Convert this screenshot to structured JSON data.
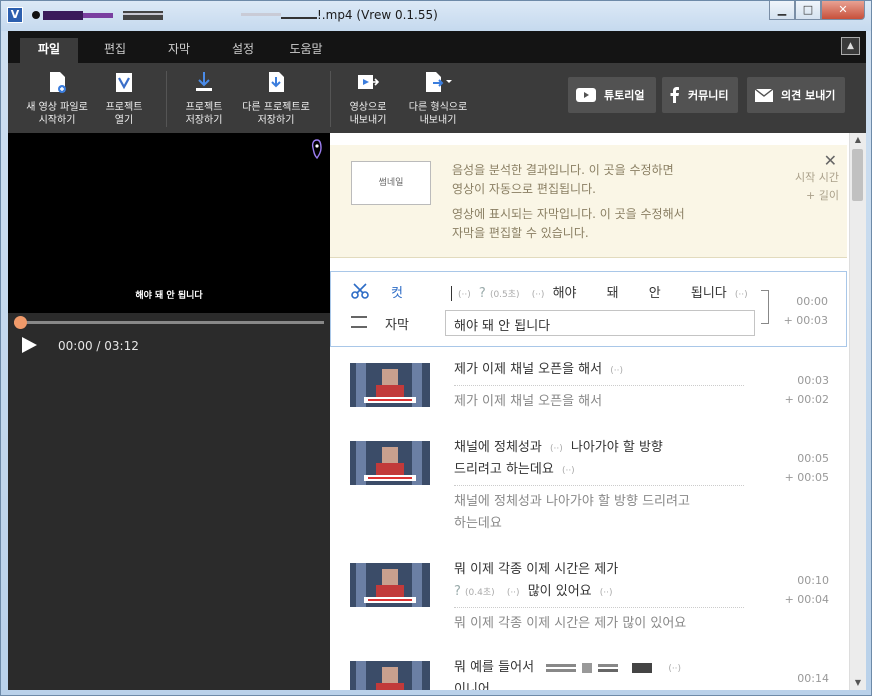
{
  "window": {
    "title": "!.mp4 (Vrew 0.1.55)",
    "app_icon": "V",
    "controls": {
      "minimize": "▁",
      "maximize": "□",
      "close": "✕"
    }
  },
  "menu": {
    "tabs": [
      "파일",
      "편집",
      "자막",
      "설정",
      "도움말"
    ],
    "active": "파일",
    "collapse_icon": "▲"
  },
  "ribbon": {
    "buttons": [
      {
        "label1": "새 영상 파일로",
        "label2": "시작하기",
        "icon": "new-file-icon"
      },
      {
        "label1": "프로젝트",
        "label2": "열기",
        "icon": "open-project-icon"
      },
      {
        "label1": "프로젝트",
        "label2": "저장하기",
        "icon": "save-icon"
      },
      {
        "label1": "다른 프로젝트로",
        "label2": "저장하기",
        "icon": "save-as-icon"
      },
      {
        "label1": "영상으로",
        "label2": "내보내기",
        "icon": "export-video-icon"
      },
      {
        "label1": "다른 형식으로",
        "label2": "내보내기",
        "icon": "export-format-icon"
      }
    ],
    "links": [
      {
        "label": "튜토리얼",
        "icon": "youtube-icon"
      },
      {
        "label": "커뮤니티",
        "icon": "facebook-icon"
      },
      {
        "label": "의견 보내기",
        "icon": "mail-icon"
      }
    ]
  },
  "player": {
    "caption": "해야 돼 안 됩니다",
    "time": "00:00 / 03:12",
    "progress": 0,
    "accent": "#f09a6a"
  },
  "tip": {
    "thumb_label": "썸네일",
    "line1a": "음성을 분석한 결과입니다. 이 곳을 수정하면",
    "line1b": "영상이 자동으로 편집됩니다.",
    "line2a": "영상에 표시되는 자막입니다. 이 곳을 수정해서",
    "line2b": "자막을 편집할 수 있습니다.",
    "start_label": "시작 시간",
    "length_label": "+ 길이",
    "close": "✕"
  },
  "editor": {
    "cut_label": "컷",
    "sub_label": "자막",
    "pause": "(··)",
    "question": "?",
    "pause_len": "(0.5초)",
    "words": [
      "해야",
      "돼",
      "안",
      "됩니다"
    ],
    "subtitle": "해야 돼 안 됩니다",
    "start": "00:00",
    "length": "+ 00:03"
  },
  "rows": [
    {
      "line1": "제가 이제 채널 오픈을 해서",
      "line1_tail": "(··)",
      "line2": "",
      "sub1": "제가 이제 채널 오픈을 해서",
      "sub2": "",
      "start": "00:03",
      "length": "+ 00:02"
    },
    {
      "line1": "채널에 정체성과",
      "line1_mid": "(··)",
      "line1_b": "나아가야 할 방향",
      "line2": "드리려고 하는데요",
      "line2_tail": "(··)",
      "sub1": "채널에 정체성과 나아가야 할 방향 드리려고",
      "sub2": "하는데요",
      "start": "00:05",
      "length": "+ 00:05"
    },
    {
      "line1": "뭐 이제 각종 이제 시간은 제가",
      "line2_q": "?",
      "line2_len": "(0.4초)",
      "line2_pause": "(··)",
      "line2": "많이 있어요",
      "line2_tail": "(··)",
      "sub1": "뭐 이제 각종 이제 시간은 제가 많이 있어요",
      "sub2": "",
      "start": "00:10",
      "length": "+ 00:04"
    },
    {
      "line1": "뭐 예를 들어서",
      "line1_tail": "(··)",
      "line2": "이니어",
      "start": "00:14"
    }
  ]
}
